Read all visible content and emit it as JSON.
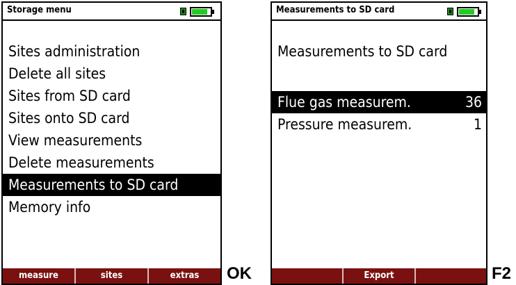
{
  "left_screen": {
    "title": "Storage menu",
    "battery_level": 0.85,
    "menu_items": [
      {
        "label": "Sites administration"
      },
      {
        "label": "Delete all sites"
      },
      {
        "label": "Sites from SD card"
      },
      {
        "label": "Sites onto SD card"
      },
      {
        "label": "View measurements"
      },
      {
        "label": "Delete measurements"
      },
      {
        "label": "Measurements to SD card"
      },
      {
        "label": "Memory info"
      }
    ],
    "selected_index": 6,
    "softkeys": [
      "measure",
      "sites",
      "extras"
    ]
  },
  "right_screen": {
    "title": "Measurements to SD card",
    "battery_level": 0.85,
    "heading": "Measurements to SD card",
    "rows": [
      {
        "label": "Flue gas measurem.",
        "count": "36"
      },
      {
        "label": "Pressure measurem.",
        "count": "1"
      }
    ],
    "selected_index": 0,
    "softkeys": [
      "",
      "Export",
      ""
    ]
  },
  "key_labels": {
    "ok": "OK",
    "f2": "F2"
  },
  "colors": {
    "softkey_bar": "#7a1111",
    "battery_green": "#22cc22",
    "selection": "#000000"
  }
}
